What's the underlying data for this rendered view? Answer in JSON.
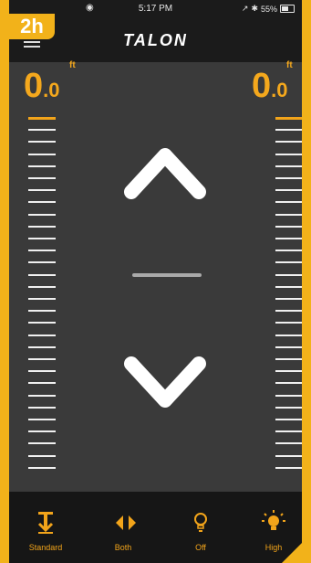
{
  "step_label": "2h",
  "status_bar": {
    "time": "5:17 PM",
    "battery": "55%",
    "wifi_icon": "wifi-icon",
    "bluetooth_icon": "bluetooth-icon",
    "location_icon": "location-icon"
  },
  "header": {
    "title": "TALON",
    "menu_icon": "menu-icon"
  },
  "depth": {
    "left": {
      "whole": "0",
      "decimal": ".0",
      "unit": "ft"
    },
    "right": {
      "whole": "0",
      "decimal": ".0",
      "unit": "ft"
    }
  },
  "controls": {
    "up_icon": "chevron-up-icon",
    "stop_icon": "stop-bar-icon",
    "down_icon": "chevron-down-icon"
  },
  "tabs": [
    {
      "label": "Standard",
      "icon": "anchor-standard-icon"
    },
    {
      "label": "Both",
      "icon": "both-arrows-icon"
    },
    {
      "label": "Off",
      "icon": "bulb-off-icon"
    },
    {
      "label": "High",
      "icon": "bulb-high-icon"
    }
  ],
  "colors": {
    "accent": "#f2a41a",
    "background": "#3a3a3a",
    "frame": "#f2b21a"
  }
}
